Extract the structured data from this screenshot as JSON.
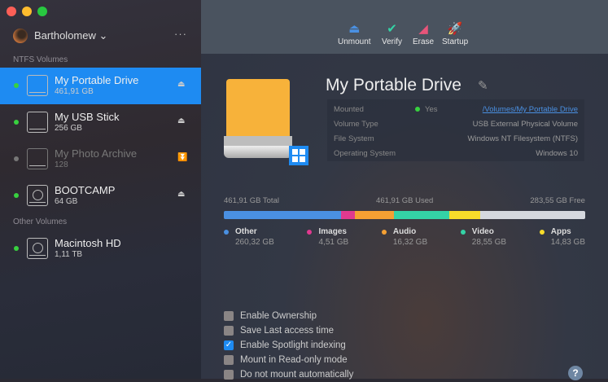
{
  "window": {
    "controls": [
      "#fd5f57",
      "#febc2e",
      "#28c840"
    ]
  },
  "sidebar": {
    "user": "Bartholomew ⌄",
    "more": "···",
    "sections": [
      "NTFS Volumes",
      "Other Volumes"
    ],
    "volumes": [
      {
        "name": "My Portable Drive",
        "size": "461,91 GB",
        "mounted": true,
        "selected": true,
        "icon": "external-drive-icon"
      },
      {
        "name": "My USB Stick",
        "size": "256 GB",
        "mounted": true,
        "icon": "external-drive-icon"
      },
      {
        "name": "My Photo Archive",
        "size": "128",
        "mounted": false,
        "icon": "external-drive-icon"
      },
      {
        "name": "BOOTCAMP",
        "size": "64 GB",
        "mounted": true,
        "icon": "hard-disk-icon"
      },
      {
        "name": "Macintosh HD",
        "size": "1,11 TB",
        "mounted": true,
        "icon": "hard-disk-icon"
      }
    ],
    "eject": "⏏",
    "mount": "⏬"
  },
  "toolbar": {
    "unmount": "Unmount",
    "verify": "Verify",
    "erase": "Erase",
    "startup": "Startup"
  },
  "detail": {
    "title": "My Portable Drive",
    "rows": [
      {
        "label": "Mounted",
        "status": "Yes",
        "value": "/Volumes/My Portable Drive"
      },
      {
        "label": "Volume Type",
        "value": "USB External Physical Volume"
      },
      {
        "label": "File System",
        "value": "Windows NT Filesystem (NTFS)"
      },
      {
        "label": "Operating System",
        "value": "Windows 10"
      }
    ],
    "total": "461,91 GB Total",
    "used": "461,91 GB Used",
    "free": "283,55 GB Free",
    "usage": [
      {
        "name": "Other",
        "value": "260,32 GB",
        "color": "#4a90e2",
        "bar_percent": 32.4
      },
      {
        "name": "Images",
        "value": "4,51 GB",
        "color": "#e0398f",
        "bar_percent": 3.8
      },
      {
        "name": "Audio",
        "value": "16,32 GB",
        "color": "#f5a033",
        "bar_percent": 10.8
      },
      {
        "name": "Video",
        "value": "28,55 GB",
        "color": "#34d3a6",
        "bar_percent": 15.3
      },
      {
        "name": "Apps",
        "value": "14,83 GB",
        "color": "#f7dc2a",
        "bar_percent": 8.6
      }
    ],
    "free_color": "#d5d8de"
  },
  "options": [
    {
      "label": "Enable Ownership",
      "checked": false
    },
    {
      "label": "Save Last access time",
      "checked": false
    },
    {
      "label": "Enable Spotlight indexing",
      "checked": true
    },
    {
      "label": "Mount in Read-only mode",
      "checked": false
    },
    {
      "label": "Do not mount automatically",
      "checked": false
    }
  ],
  "help": "?"
}
